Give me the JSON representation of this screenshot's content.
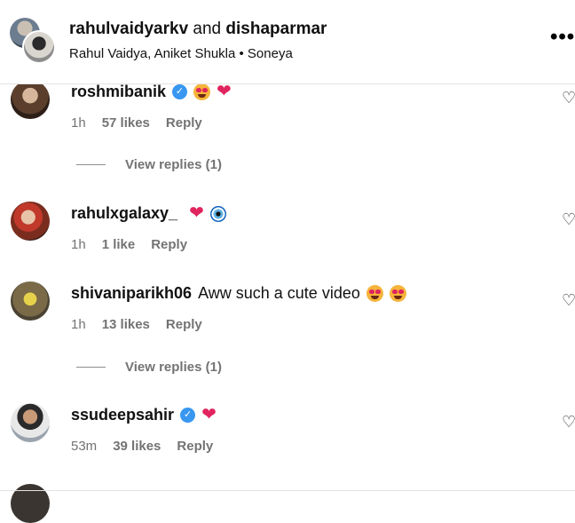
{
  "header": {
    "user1": "rahulvaidyarkv",
    "joiner": "and",
    "user2": "dishaparmar",
    "subtitle": "Rahul Vaidya, Aniket Shukla • Soneya",
    "more_icon": "more-horizontal-icon"
  },
  "comments": [
    {
      "username": "roshmibanik",
      "verified": true,
      "text": "",
      "emojis": [
        "heart-eyes",
        "red-heart"
      ],
      "time": "1h",
      "likes": "57 likes",
      "reply": "Reply",
      "view_replies": "View replies (1)"
    },
    {
      "username": "rahulxgalaxy_",
      "verified": false,
      "text": "",
      "emojis": [
        "red-heart",
        "evil-eye"
      ],
      "time": "1h",
      "likes": "1 like",
      "reply": "Reply"
    },
    {
      "username": "shivaniparikh06",
      "verified": false,
      "text": "Aww such a cute video",
      "emojis": [
        "heart-eyes",
        "heart-eyes"
      ],
      "time": "1h",
      "likes": "13 likes",
      "reply": "Reply",
      "view_replies": "View replies (1)"
    },
    {
      "username": "ssudeepsahir",
      "verified": true,
      "text": "",
      "emojis": [
        "red-heart"
      ],
      "time": "53m",
      "likes": "39 likes",
      "reply": "Reply"
    }
  ],
  "colors": {
    "verified": "#3897f0",
    "meta_gray": "#737373",
    "heart_red": "#e0245e"
  }
}
